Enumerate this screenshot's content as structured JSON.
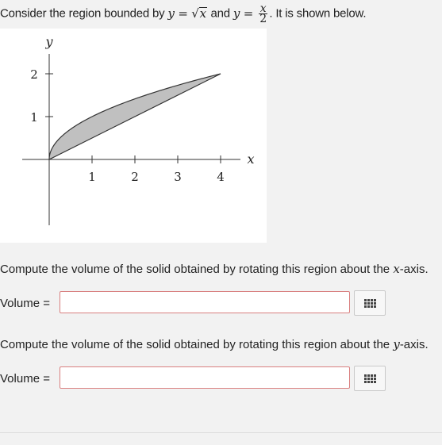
{
  "intro": {
    "prefix": "Consider the region bounded by",
    "eq1_lhs": "y",
    "eq1_op": "=",
    "eq1_radicand": "x",
    "joiner": "and",
    "eq2_lhs": "y",
    "eq2_op": "=",
    "eq2_num": "x",
    "eq2_den": "2",
    "suffix": ". It is shown below."
  },
  "graph": {
    "ylabel": "y",
    "xlabel": "x",
    "xticks": [
      "1",
      "2",
      "3",
      "4"
    ],
    "yticks": [
      "1",
      "2"
    ],
    "fill_color": "#c0c0c0"
  },
  "questions": [
    {
      "prefix": "Compute the volume of the solid obtained by rotating this region about the",
      "var": "x",
      "suffix": "-axis.",
      "label": "Volume =",
      "value": ""
    },
    {
      "prefix": "Compute the volume of the solid obtained by rotating this region about the",
      "var": "y",
      "suffix": "-axis.",
      "label": "Volume =",
      "value": ""
    }
  ],
  "colors": {
    "input_border": "#d98080",
    "background": "#f2f2f2"
  },
  "icons": {
    "keyboard": "grid-keypad-icon"
  }
}
